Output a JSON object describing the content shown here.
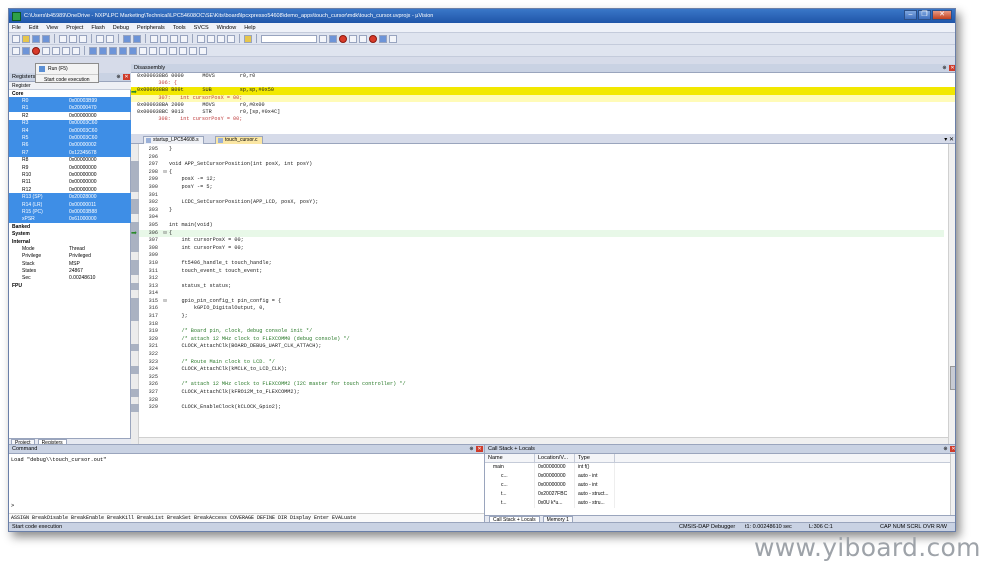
{
  "window": {
    "title": "C:\\Users\\b45989\\OneDrive - NXP\\LPC Marketing\\Technical\\LPC54608OC\\SE\\Kits\\board\\lpcxpresso54608\\demo_apps\\touch_cursor\\mdk\\touch_cursor.uvprojx - µVision",
    "buttons": [
      "–",
      "❐",
      "✕"
    ]
  },
  "menu": [
    "File",
    "Edit",
    "View",
    "Project",
    "Flash",
    "Debug",
    "Peripherals",
    "Tools",
    "SVCS",
    "Window",
    "Help"
  ],
  "tooltip": {
    "title": "Run (F5)",
    "text": "Start code execution"
  },
  "registers_panel": {
    "title": "Registers",
    "col_register": "Register",
    "rows": [
      {
        "name": "Core",
        "value": "",
        "sel": false,
        "indent": 0
      },
      {
        "name": "R0",
        "value": "0x00003B99",
        "sel": true,
        "indent": 2
      },
      {
        "name": "R1",
        "value": "0x20000470",
        "sel": true,
        "indent": 2
      },
      {
        "name": "R2",
        "value": "0x00000000",
        "sel": false,
        "indent": 2
      },
      {
        "name": "R3",
        "value": "0x00003C60",
        "sel": true,
        "indent": 2
      },
      {
        "name": "R4",
        "value": "0x00003C60",
        "sel": true,
        "indent": 2
      },
      {
        "name": "R5",
        "value": "0x00003C60",
        "sel": true,
        "indent": 2
      },
      {
        "name": "R6",
        "value": "0x00000002",
        "sel": true,
        "indent": 2
      },
      {
        "name": "R7",
        "value": "0x12345678",
        "sel": true,
        "indent": 2
      },
      {
        "name": "R8",
        "value": "0x00000000",
        "sel": false,
        "indent": 2
      },
      {
        "name": "R9",
        "value": "0x00000000",
        "sel": false,
        "indent": 2
      },
      {
        "name": "R10",
        "value": "0x00000000",
        "sel": false,
        "indent": 2
      },
      {
        "name": "R11",
        "value": "0x00000000",
        "sel": false,
        "indent": 2
      },
      {
        "name": "R12",
        "value": "0x00000000",
        "sel": false,
        "indent": 2
      },
      {
        "name": "R13 (SP)",
        "value": "0x20028000",
        "sel": true,
        "indent": 2
      },
      {
        "name": "R14 (LR)",
        "value": "0x00000011",
        "sel": true,
        "indent": 2
      },
      {
        "name": "R15 (PC)",
        "value": "0x00003B88",
        "sel": true,
        "indent": 2
      },
      {
        "name": "xPSR",
        "value": "0x61000000",
        "sel": true,
        "indent": 2
      },
      {
        "name": "Banked",
        "value": "",
        "sel": false,
        "indent": 0
      },
      {
        "name": "System",
        "value": "",
        "sel": false,
        "indent": 0
      },
      {
        "name": "Internal",
        "value": "",
        "sel": false,
        "indent": 0
      },
      {
        "name": "Mode",
        "value": "Thread",
        "sel": false,
        "indent": 2
      },
      {
        "name": "Privilege",
        "value": "Privileged",
        "sel": false,
        "indent": 2
      },
      {
        "name": "Stack",
        "value": "MSP",
        "sel": false,
        "indent": 2
      },
      {
        "name": "States",
        "value": "24867",
        "sel": false,
        "indent": 2
      },
      {
        "name": "Sec",
        "value": "0.00248610",
        "sel": false,
        "indent": 2
      },
      {
        "name": "FPU",
        "value": "",
        "sel": false,
        "indent": 0
      }
    ],
    "tabs": [
      "Project",
      "Registers"
    ]
  },
  "disassembly": {
    "title": "Disassembly",
    "lines": [
      {
        "text": "0x000038B6 0000      MOVS        r0,r0",
        "cls": ""
      },
      {
        "text": "   306: {",
        "cls": "src"
      },
      {
        "text": "0x000038B8 B09t      SUB         sp,sp,#0x50",
        "cls": "hl"
      },
      {
        "text": "   307:   int cursorPosX = 00;",
        "cls": "src hl2"
      },
      {
        "text": "0x000038BA 2000      MOVS        r0,#0x00",
        "cls": ""
      },
      {
        "text": "0x000038BC 9013      STR         r0,[sp,#0x4C]",
        "cls": ""
      },
      {
        "text": "   308:   int cursorPosY = 00;",
        "cls": "src"
      }
    ]
  },
  "editor": {
    "tabs": [
      "startup_LPC54608.s",
      "touch_cursor.c"
    ],
    "lines": [
      {
        "n": "295",
        "t": "}"
      },
      {
        "n": "296",
        "t": ""
      },
      {
        "n": "297",
        "t": "void APP_SetCursorPosition(int posX, int posY)"
      },
      {
        "n": "298",
        "t": "{",
        "fold": "⊟"
      },
      {
        "n": "299",
        "t": "    posX -= 12;"
      },
      {
        "n": "300",
        "t": "    posY -= 5;"
      },
      {
        "n": "301",
        "t": ""
      },
      {
        "n": "302",
        "t": "    LCDC_SetCursorPosition(APP_LCD, posX, posY);"
      },
      {
        "n": "303",
        "t": "}"
      },
      {
        "n": "304",
        "t": ""
      },
      {
        "n": "305",
        "t": "int main(void)"
      },
      {
        "n": "306",
        "t": "{",
        "fold": "⊟",
        "cur": true
      },
      {
        "n": "307",
        "t": "    int cursorPosX = 00;"
      },
      {
        "n": "308",
        "t": "    int cursorPosY = 00;"
      },
      {
        "n": "309",
        "t": ""
      },
      {
        "n": "310",
        "t": "    ft5406_handle_t touch_handle;"
      },
      {
        "n": "311",
        "t": "    touch_event_t touch_event;"
      },
      {
        "n": "312",
        "t": ""
      },
      {
        "n": "313",
        "t": "    status_t status;"
      },
      {
        "n": "314",
        "t": ""
      },
      {
        "n": "315",
        "t": "    gpio_pin_config_t pin_config = {",
        "fold": "⊟"
      },
      {
        "n": "316",
        "t": "        kGPIO_DigitalOutput, 0,"
      },
      {
        "n": "317",
        "t": "    };"
      },
      {
        "n": "318",
        "t": ""
      },
      {
        "n": "319",
        "t": "    /* Board pin, clock, debug console init */",
        "cm": true
      },
      {
        "n": "320",
        "t": "    /* attach 12 MHz clock to FLEXCOMM0 (debug console) */",
        "cm": true
      },
      {
        "n": "321",
        "t": "    CLOCK_AttachClk(BOARD_DEBUG_UART_CLK_ATTACH);"
      },
      {
        "n": "322",
        "t": ""
      },
      {
        "n": "323",
        "t": "    /* Route Main clock to LCD. */",
        "cm": true
      },
      {
        "n": "324",
        "t": "    CLOCK_AttachClk(kMCLK_to_LCD_CLK);"
      },
      {
        "n": "325",
        "t": ""
      },
      {
        "n": "326",
        "t": "    /* attach 12 MHz clock to FLEXCOMM2 (I2C master for touch controller) */",
        "cm": true
      },
      {
        "n": "327",
        "t": "    CLOCK_AttachClk(kFRO12M_to_FLEXCOMM2);"
      },
      {
        "n": "328",
        "t": ""
      },
      {
        "n": "329",
        "t": "    CLOCK_EnableClock(kCLOCK_Gpio2);"
      }
    ]
  },
  "command": {
    "title": "Command",
    "output": "Load \"debug\\\\touch_cursor.out\"",
    "prompt": ">",
    "assign_line": "ASSIGN BreakDisable BreakEnable BreakKill BreakList BreakSet BreakAccess COVERAGE DEFINE DIR Display Enter EVALuate"
  },
  "callstack": {
    "title": "Call Stack + Locals",
    "cols": [
      "Name",
      "Location/V...",
      "Type"
    ],
    "rows": [
      {
        "name": "main",
        "loc": "0x00000000",
        "type": "int f()"
      },
      {
        "name": "c...",
        "loc": "0x00000000",
        "type": "auto - int"
      },
      {
        "name": "c...",
        "loc": "0x00000000",
        "type": "auto - int"
      },
      {
        "name": "t...",
        "loc": "0x20027FBC",
        "type": "auto - struct..."
      },
      {
        "name": "t...",
        "loc": "0x0U k*u...",
        "type": "auto - stru..."
      }
    ],
    "tabs": [
      "Call Stack + Locals",
      "Memory 1"
    ]
  },
  "statusbar": {
    "left": "Start code execution",
    "debugger": "CMSIS-DAP Debugger",
    "time": "t1: 0.00248610 sec",
    "pos": "L:306 C:1",
    "flags": "CAP  NUM  SCRL  OVR  R/W"
  },
  "watermark": "www.yiboard.com"
}
